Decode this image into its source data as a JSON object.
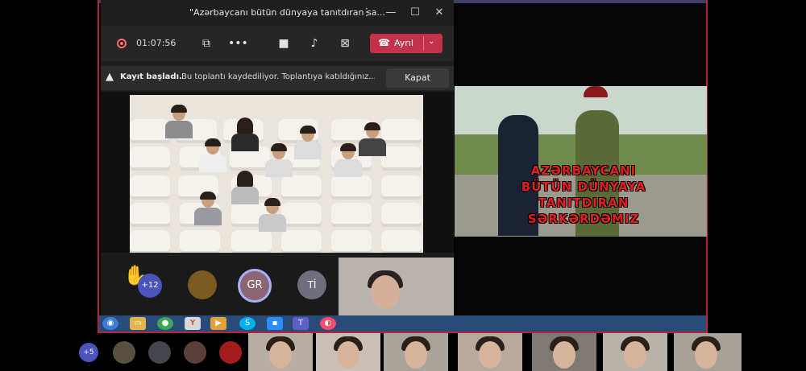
{
  "window": {
    "title": "\"Azərbaycanı bütün dünyaya tanıtdıran sa..."
  },
  "toolbar": {
    "timer": "01:07:56",
    "leave_label": "Ayrıl"
  },
  "recording_banner": {
    "bold": "Kayıt başladı.",
    "message": "Bu toplantı kaydediliyor. Toplantıya katıldığınız...",
    "close_label": "Kapat"
  },
  "participants": {
    "raised_count": "+12",
    "gr_initials": "GR",
    "ti_initials": "Tİ",
    "strip_count": "+5"
  },
  "shared_content": {
    "lines": [
      "AZƏRBAYCANI",
      "BÜTÜN DÜNYAYA",
      "TANITDIRAN",
      "SƏRKƏRDƏMIZ"
    ]
  },
  "colors": {
    "accent_red": "#c4314b",
    "teams_purple": "#4b53bc",
    "frame_red": "#b1283e",
    "text_red": "#e51d1d"
  },
  "icons": [
    "record-icon",
    "share-screen-icon",
    "more-icon",
    "camera-icon",
    "mic-icon",
    "stop-share-icon",
    "phone-icon",
    "warning-icon",
    "raised-hand-icon"
  ]
}
